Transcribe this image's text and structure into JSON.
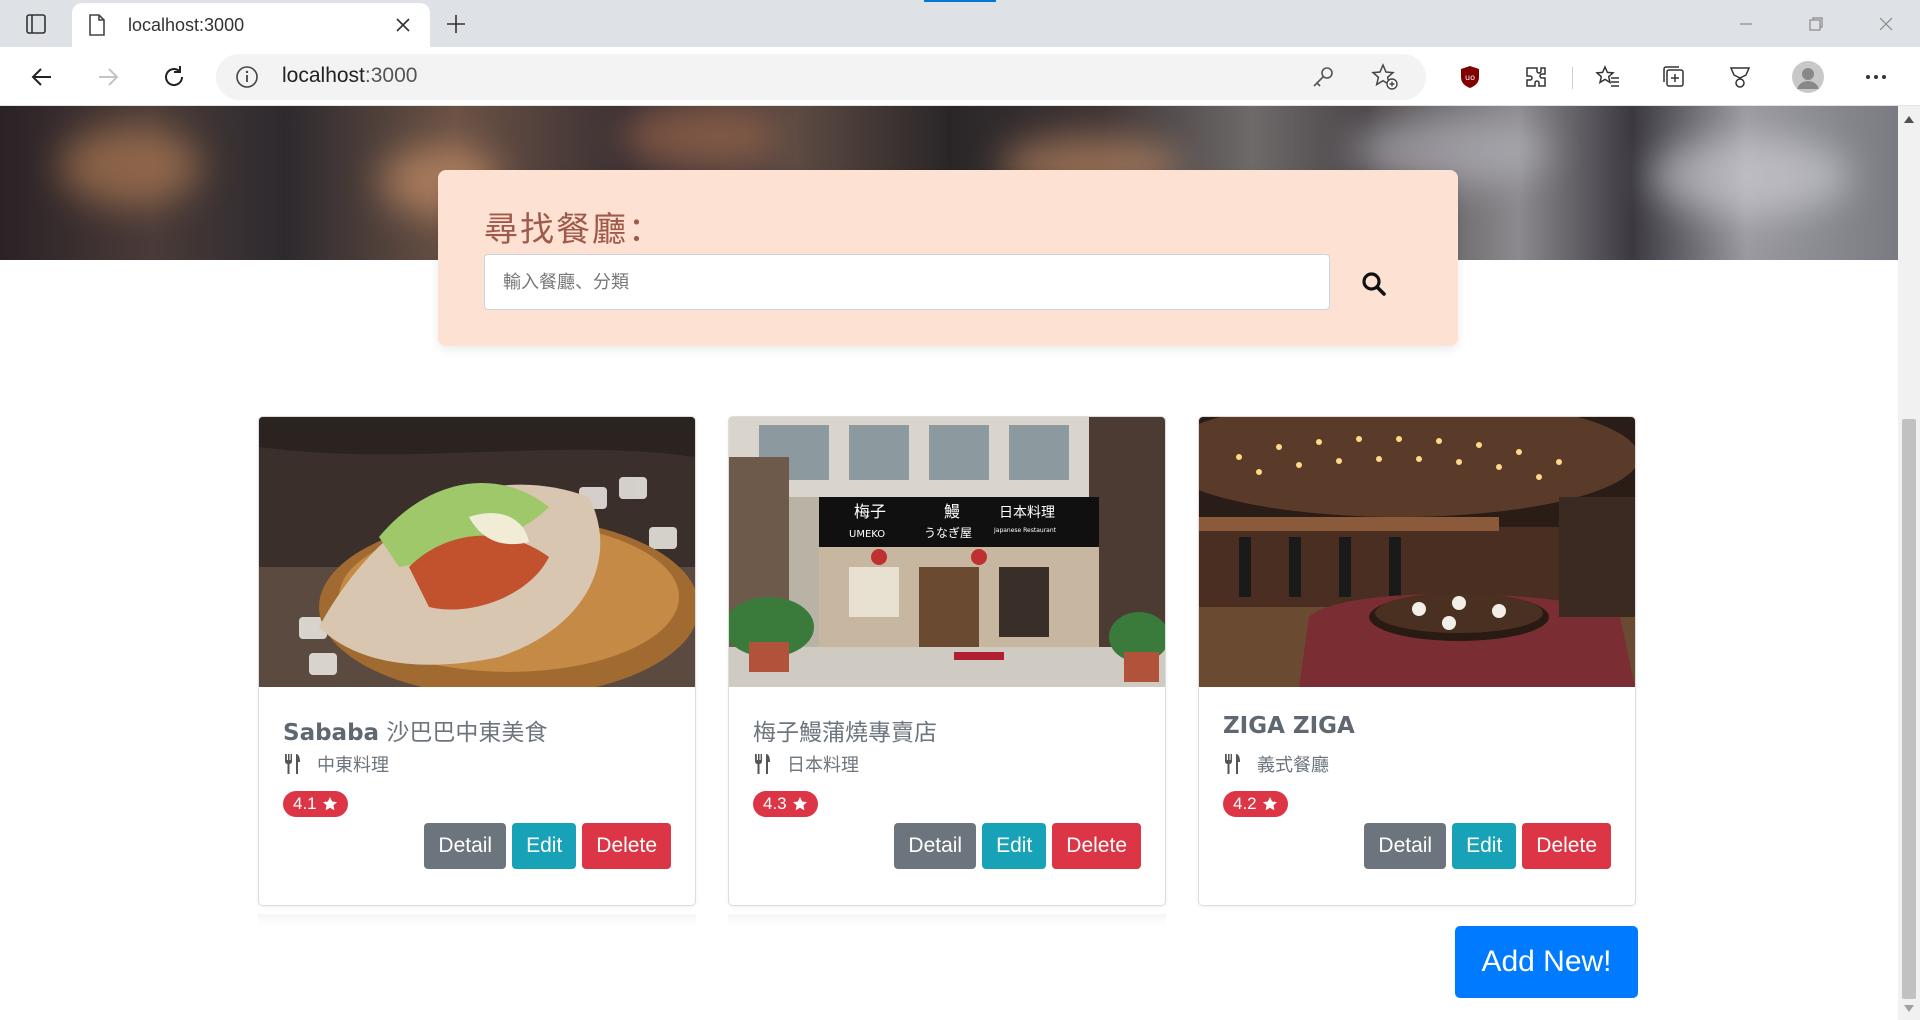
{
  "browser": {
    "tab_title": "localhost:3000",
    "url_host": "localhost",
    "url_port": ":3000"
  },
  "search": {
    "title": "尋找餐廳：",
    "placeholder": "輸入餐廳、分類",
    "value": ""
  },
  "restaurants": [
    {
      "name_latin": "Sababa",
      "name_cjk": " 沙巴巴中東美食",
      "category": "中東料理",
      "rating": "4.1"
    },
    {
      "name_latin": "",
      "name_cjk": "梅子鰻蒲燒專賣店",
      "category": "日本料理",
      "rating": "4.3",
      "sign_text": [
        "梅子",
        "UMEKO",
        "鰻",
        "うなぎ屋",
        "日本料理",
        "Japanese Restaurant"
      ]
    },
    {
      "name_latin": "ZIGA ZIGA",
      "name_cjk": "",
      "category": "義式餐廳",
      "rating": "4.2"
    }
  ],
  "buttons": {
    "detail": "Detail",
    "edit": "Edit",
    "delete": "Delete",
    "add_new": "Add New!"
  },
  "colors": {
    "search_panel_bg": "#fde2d3",
    "badge": "#dc3545",
    "detail": "#6c757d",
    "edit": "#17a2b8",
    "delete": "#dc3545",
    "primary": "#007bff"
  }
}
